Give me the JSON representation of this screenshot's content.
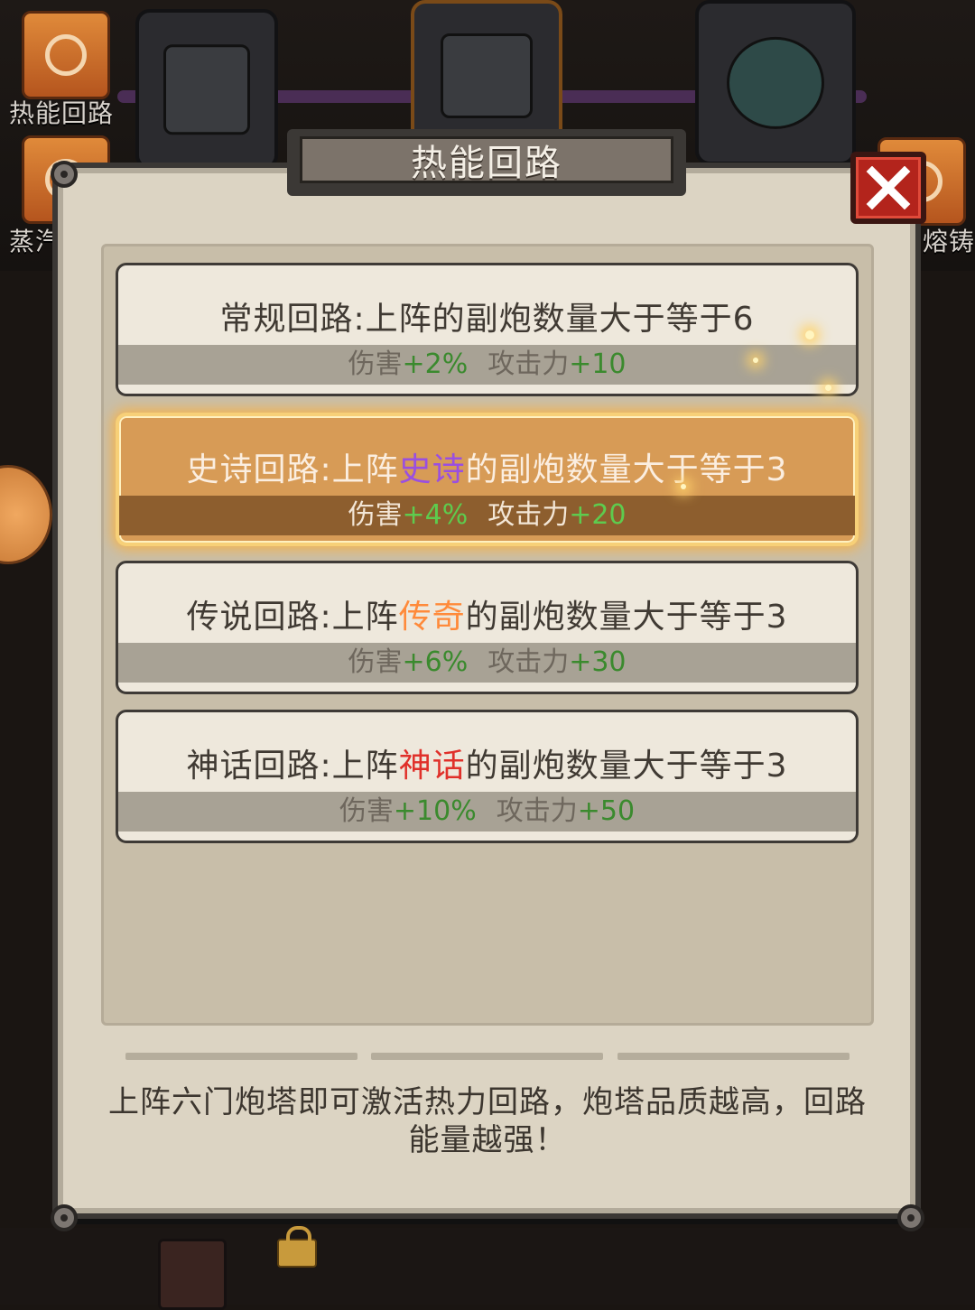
{
  "background": {
    "side_items": [
      {
        "label": "热能回路",
        "icon": "thermal-circuit-icon"
      },
      {
        "label": "蒸汽",
        "icon": "steam-icon"
      },
      {
        "label": "熔铸",
        "icon": "casting-icon"
      }
    ]
  },
  "dialog": {
    "title": "热能回路",
    "close_icon": "close-icon",
    "circuits": [
      {
        "name_prefix": "常规回路:上阵的副炮数量大于等于6",
        "highlight": "",
        "name_suffix": "",
        "damage_label": "伤害",
        "damage_value": "+2%",
        "attack_label": "攻击力",
        "attack_value": "+10",
        "active": false
      },
      {
        "name_prefix": "史诗回路:上阵",
        "highlight": "史诗",
        "name_suffix": "的副炮数量大于等于3",
        "damage_label": "伤害",
        "damage_value": "+4%",
        "attack_label": "攻击力",
        "attack_value": "+20",
        "active": true
      },
      {
        "name_prefix": "传说回路:上阵",
        "highlight": "传奇",
        "name_suffix": "的副炮数量大于等于3",
        "damage_label": "伤害",
        "damage_value": "+6%",
        "attack_label": "攻击力",
        "attack_value": "+30",
        "active": false
      },
      {
        "name_prefix": "神话回路:上阵",
        "highlight": "神话",
        "name_suffix": "的副炮数量大于等于3",
        "damage_label": "伤害",
        "damage_value": "+10%",
        "attack_label": "攻击力",
        "attack_value": "+50",
        "active": false
      }
    ],
    "description": "上阵六门炮塔即可激活热力回路，炮塔品质越高，回路能量越强！"
  },
  "colors": {
    "epic": "#9a4fe0",
    "legendary": "#ff8a3a",
    "mythic": "#e0302a",
    "bonus_green": "#3b8a2e",
    "close_red": "#b3241c"
  }
}
